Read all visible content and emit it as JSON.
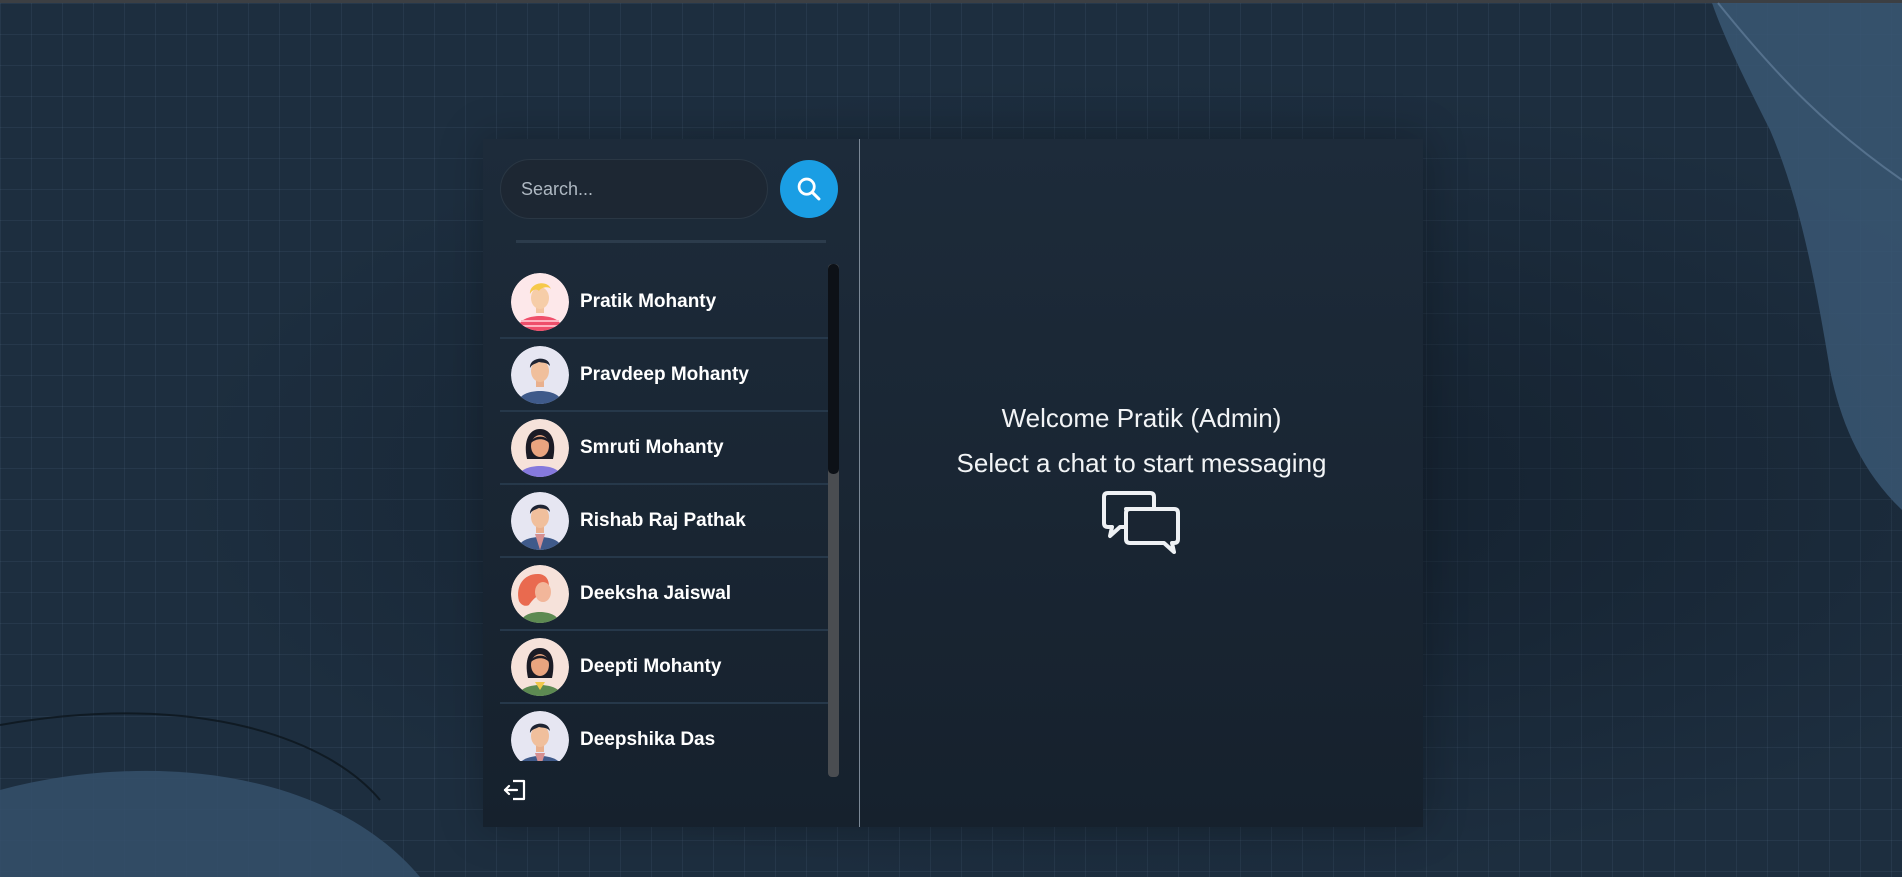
{
  "search": {
    "placeholder": "Search...",
    "button_icon": "search-icon"
  },
  "users": [
    {
      "name": "Pratik Mohanty",
      "avatar": "avatar-blond-man"
    },
    {
      "name": "Pravdeep Mohanty",
      "avatar": "avatar-dark-hair-man"
    },
    {
      "name": "Smruti Mohanty",
      "avatar": "avatar-dark-hair-woman"
    },
    {
      "name": "Rishab Raj Pathak",
      "avatar": "avatar-dark-hair-man"
    },
    {
      "name": "Deeksha Jaiswal",
      "avatar": "avatar-red-hair-woman"
    },
    {
      "name": "Deepti Mohanty",
      "avatar": "avatar-dark-hair-woman"
    },
    {
      "name": "Deepshika Das",
      "avatar": "avatar-dark-hair-man"
    }
  ],
  "welcome": {
    "title": "Welcome Pratik (Admin)",
    "subtitle": "Select a chat to start messaging",
    "icon": "chat-bubbles-icon"
  },
  "logout": {
    "icon": "logout-icon"
  },
  "colors": {
    "accent": "#1a9ee4",
    "background": "#1c2d3e",
    "card": "#1a2532",
    "text": "#ffffff"
  }
}
